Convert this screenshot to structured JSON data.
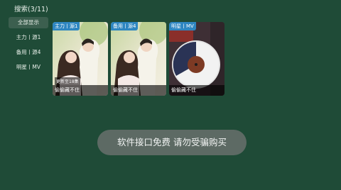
{
  "header": {
    "title": "搜索(3/11)"
  },
  "sidebar": {
    "items": [
      {
        "label": "全部显示"
      },
      {
        "label": "主力丨源1"
      },
      {
        "label": "备用丨源4"
      },
      {
        "label": "明星丨MV"
      }
    ]
  },
  "results": [
    {
      "badge": "主力丨源1",
      "update": "更新至18集",
      "title": "偷偷藏不住"
    },
    {
      "badge": "备用丨源4",
      "update": "",
      "title": "偷偷藏不住"
    },
    {
      "badge": "明星丨MV",
      "update": "",
      "title": "偷偷藏不住"
    }
  ],
  "toast": {
    "text": "软件接口免费 请勿受骗购买"
  },
  "colors": {
    "background": "#1f4b37",
    "badge": "#2e86c1",
    "toast": "#5d6a64"
  }
}
